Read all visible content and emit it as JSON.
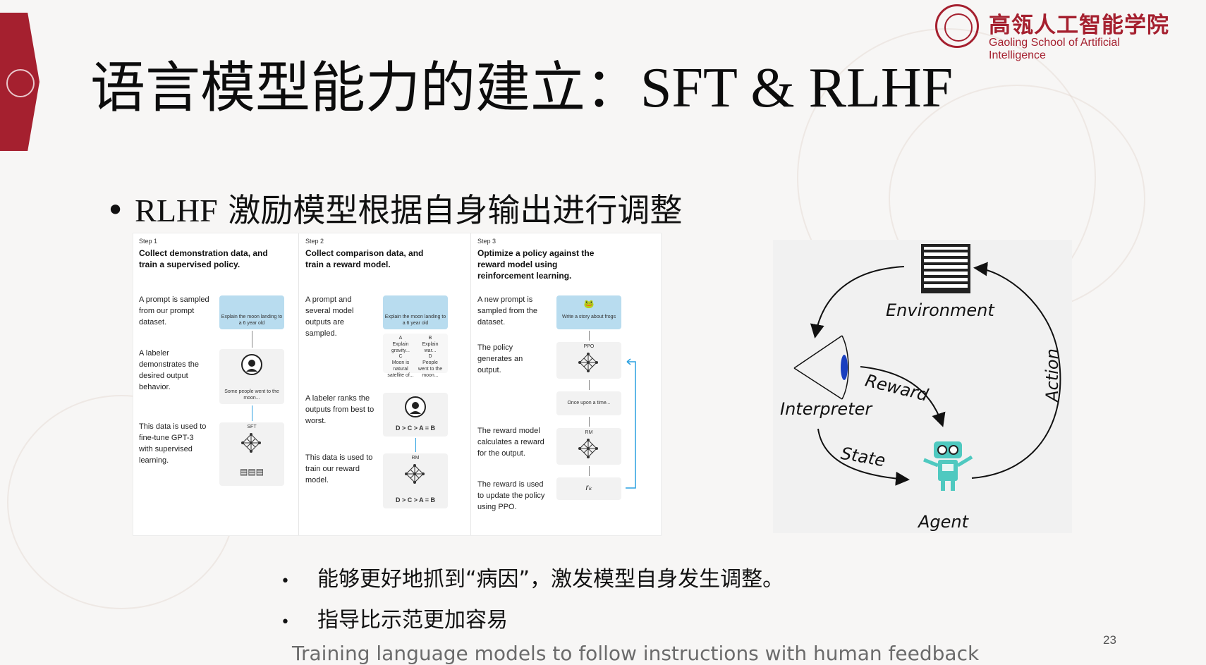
{
  "logo": {
    "cn": "高瓴人工智能学院",
    "en": "Gaoling School of Artificial Intelligence"
  },
  "title": {
    "cn": "语言模型能力的建立：",
    "en": "SFT & RLHF"
  },
  "bullet_main": {
    "lat": "RLHF",
    "cn": " 激励模型根据自身输出进行调整"
  },
  "figure": {
    "step1": {
      "step": "Step 1",
      "heading": "Collect demonstration data, and train a supervised policy.",
      "desc1": "A prompt is sampled from our prompt dataset.",
      "prompt": "Explain the moon landing to a 6 year old",
      "desc2": "A labeler demonstrates the desired output behavior.",
      "demo_text": "Some people went to the moon...",
      "desc3": "This data is used to fine-tune GPT-3 with supervised learning.",
      "model": "SFT"
    },
    "step2": {
      "step": "Step 2",
      "heading": "Collect comparison data, and train a reward model.",
      "desc1": "A prompt and several model outputs are sampled.",
      "prompt": "Explain the moon landing to a 6 year old",
      "outputs": [
        {
          "id": "A",
          "text": "Explain gravity..."
        },
        {
          "id": "B",
          "text": "Explain war..."
        },
        {
          "id": "C",
          "text": "Moon is natural satellite of..."
        },
        {
          "id": "D",
          "text": "People went to the moon..."
        }
      ],
      "desc2": "A labeler ranks the outputs from best to worst.",
      "ranking": "D > C > A = B",
      "desc3": "This data is used to train our reward model.",
      "model": "RM"
    },
    "step3": {
      "step": "Step 3",
      "heading": "Optimize a policy against the reward model using reinforcement learning.",
      "desc1": "A new prompt is sampled from the dataset.",
      "prompt": "Write a story about frogs",
      "desc2": "The policy generates an output.",
      "policy": "PPO",
      "output": "Once upon a time...",
      "desc3": "The reward model calculates a reward for the output.",
      "rm": "RM",
      "desc4": "The reward is used to update the policy using PPO.",
      "reward": "rₖ"
    }
  },
  "rl_diagram": {
    "environment": "Environment",
    "interpreter": "Interpreter",
    "reward": "Reward",
    "state": "State",
    "action": "Action",
    "agent": "Agent"
  },
  "bullets": [
    "能够更好地抓到“病因”，激发模型自身发生调整。",
    "指导比示范更加容易"
  ],
  "page_number": "23",
  "caption": "Training language models to follow instructions with human feedback",
  "colors": {
    "brand_red": "#a5202f",
    "prompt_blue": "#b8dcef",
    "arrow_blue": "#2aa0e0",
    "robot_teal": "#4fc9c0"
  }
}
